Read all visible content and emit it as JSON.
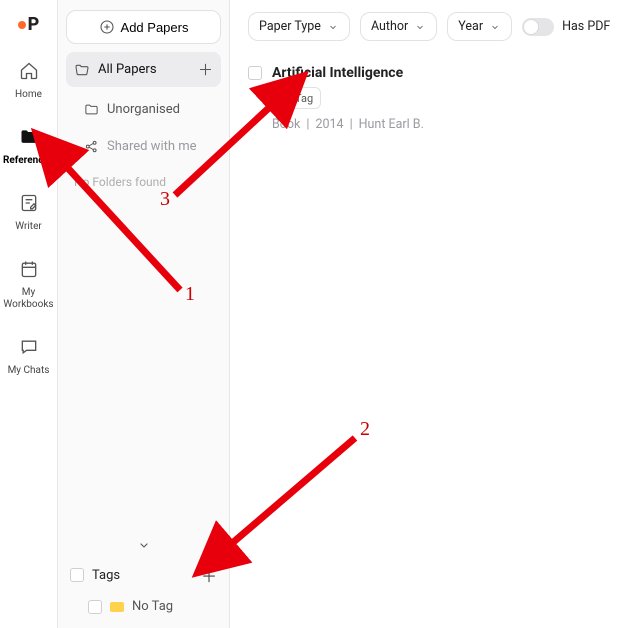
{
  "rail": {
    "items": [
      {
        "name": "home",
        "label": "Home"
      },
      {
        "name": "references",
        "label": "References"
      },
      {
        "name": "writer",
        "label": "Writer"
      },
      {
        "name": "workbooks",
        "label": "My Workbooks"
      },
      {
        "name": "chats",
        "label": "My Chats"
      }
    ],
    "active": "references"
  },
  "panel": {
    "add_button": "Add Papers",
    "folders": {
      "all": "All Papers",
      "unorganised": "Unorganised",
      "shared": "Shared with me",
      "empty": "No Folders found"
    },
    "tags": {
      "header": "Tags",
      "none": "No Tag"
    }
  },
  "filters": {
    "paper_type": "Paper Type",
    "author": "Author",
    "year": "Year",
    "has_pdf": "Has PDF",
    "has_pdf_on": false
  },
  "paper": {
    "title": "Artificial Intelligence",
    "add_tag": "Tag",
    "type": "Book",
    "year": "2014",
    "author": "Hunt Earl B."
  },
  "annotations": {
    "a1": "1",
    "a2": "2",
    "a3": "3"
  },
  "colors": {
    "accent": "#ff6a2b",
    "arrow": "#e7000b"
  }
}
